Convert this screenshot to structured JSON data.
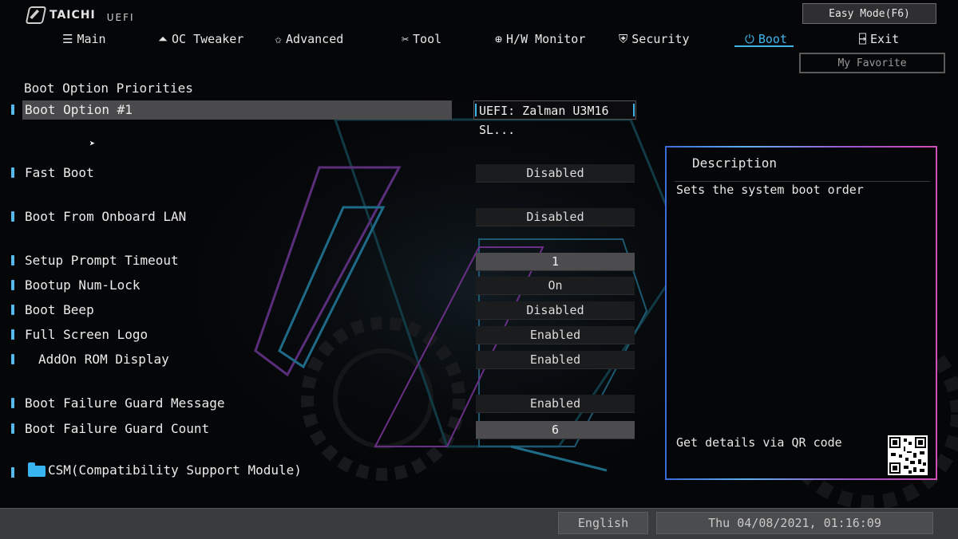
{
  "header": {
    "brand": "TAICHI",
    "uefi": "UEFI",
    "easy_mode": "Easy Mode(F6)",
    "my_favorite": "My Favorite"
  },
  "nav": {
    "tabs": [
      {
        "label": "Main",
        "icon": "list-icon"
      },
      {
        "label": "OC Tweaker",
        "icon": "rocket-icon"
      },
      {
        "label": "Advanced",
        "icon": "star-icon"
      },
      {
        "label": "Tool",
        "icon": "wrench-icon"
      },
      {
        "label": "H/W Monitor",
        "icon": "target-icon"
      },
      {
        "label": "Security",
        "icon": "shield-icon"
      },
      {
        "label": "Boot",
        "icon": "power-icon",
        "active": true
      },
      {
        "label": "Exit",
        "icon": "exit-door-icon"
      }
    ]
  },
  "main": {
    "section_title": "Boot Option Priorities",
    "boot_option_1": {
      "label": "Boot Option #1",
      "value": "UEFI: Zalman U3M16 SL..."
    },
    "settings": [
      {
        "label": "Fast Boot",
        "value": "Disabled"
      },
      {
        "label": "Boot From Onboard LAN",
        "value": "Disabled"
      },
      {
        "label": "Setup Prompt Timeout",
        "value": "1"
      },
      {
        "label": "Bootup Num-Lock",
        "value": "On"
      },
      {
        "label": "Boot Beep",
        "value": "Disabled"
      },
      {
        "label": "Full Screen Logo",
        "value": "Enabled"
      },
      {
        "label": "AddOn ROM Display",
        "value": "Enabled"
      },
      {
        "label": "Boot Failure Guard Message",
        "value": "Enabled"
      },
      {
        "label": "Boot Failure Guard Count",
        "value": "6"
      }
    ],
    "csm": {
      "label": "CSM(Compatibility Support Module)"
    }
  },
  "description": {
    "title": "Description",
    "text": "Sets the system boot order",
    "qr_text": "Get details via QR code"
  },
  "footer": {
    "language": "English",
    "datetime": "Thu 04/08/2021, 01:16:09"
  },
  "colors": {
    "accent": "#3fb5ec",
    "background": "#050608",
    "panel_border_start": "#5fb0f0",
    "panel_border_end": "#d04fb8"
  }
}
